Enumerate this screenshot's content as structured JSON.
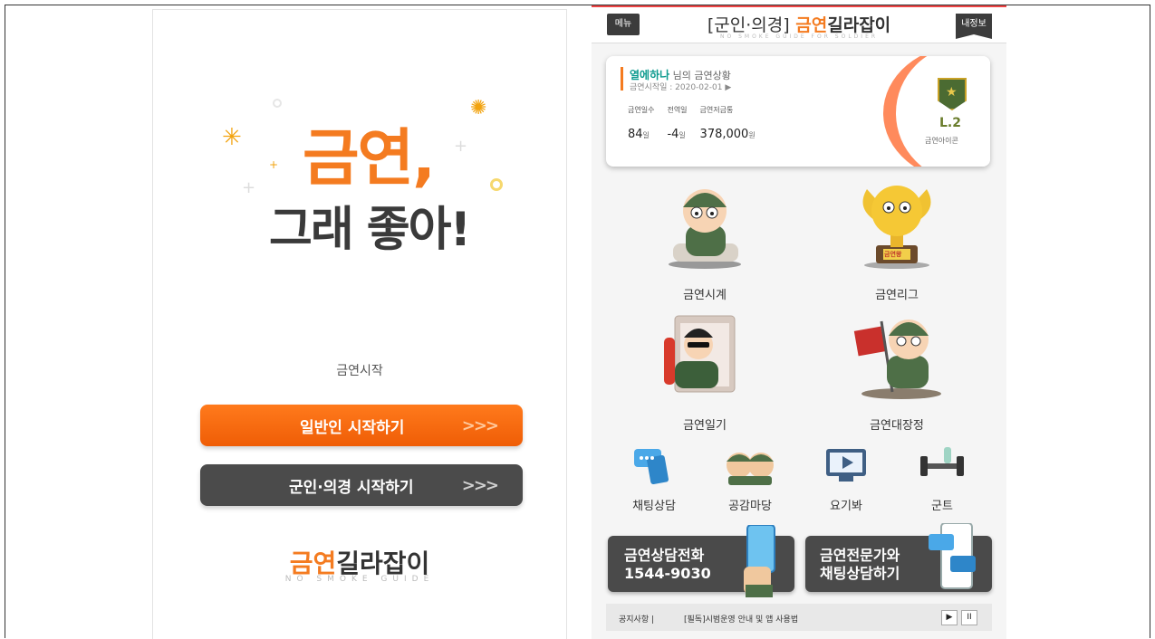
{
  "left_screen": {
    "hero_line1": "금연,",
    "hero_line2": "그래 좋아!",
    "start_label": "금연시작",
    "btn_civilian": {
      "label": "일반인 시작하기",
      "arrows": ">>>"
    },
    "btn_military": {
      "label": "군인·의경 시작하기",
      "arrows": ">>>"
    },
    "logo_accent": "금연",
    "logo_rest": "길라잡이",
    "logo_sub": "NO SMOKE GUIDE"
  },
  "right_screen": {
    "header": {
      "menu_label": "메뉴",
      "title_bracket": "[군인·의경]",
      "title_accent": "금연",
      "title_rest": "길라잡이",
      "title_sub": "NO SMOKE GUIDE FOR SOLDIER",
      "myinfo_label": "내정보"
    },
    "status": {
      "user_name": "열에하나",
      "name_suffix": "님의 금연상황",
      "start_date": "금연시작일 : 2020-02-01 ▶",
      "stats": [
        {
          "header": "금연일수",
          "value": "84",
          "unit": "일"
        },
        {
          "header": "전역일",
          "value": "-4",
          "unit": "일"
        },
        {
          "header": "금연저금통",
          "value": "378,000",
          "unit": "원"
        }
      ],
      "level": "L.2",
      "level_label": "금연아이콘"
    },
    "features": [
      {
        "label": "금연시계"
      },
      {
        "label": "금연리그"
      },
      {
        "label": "금연일기"
      },
      {
        "label": "금연대장정"
      }
    ],
    "trophy_text": "금연왕",
    "minis": [
      {
        "label": "채팅상담"
      },
      {
        "label": "공감마당"
      },
      {
        "label": "요기봐"
      },
      {
        "label": "군트"
      }
    ],
    "card_phone": {
      "line1": "금연상담전화",
      "line2": "1544-9030"
    },
    "card_chat": {
      "line1": "금연전문가와",
      "line2": "채팅상담하기"
    },
    "notice": {
      "title": "공지사항 |",
      "text": "[필독]시범운영 안내 및 앱 사용법",
      "play": "▶",
      "pause": "II"
    }
  },
  "colors": {
    "brand_orange": "#f47b20",
    "dark_button": "#4b4b4b",
    "accent_teal": "#0b9a8e"
  }
}
